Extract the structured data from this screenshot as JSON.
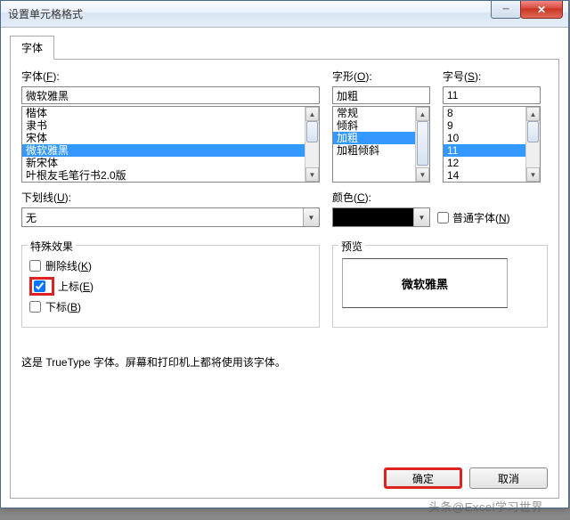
{
  "window": {
    "title": "设置单元格格式"
  },
  "tab": {
    "label": "字体"
  },
  "font": {
    "label": "字体(",
    "accel": "F",
    "label2": "):",
    "value": "微软雅黑",
    "list": [
      "楷体",
      "隶书",
      "宋体",
      "微软雅黑",
      "新宋体",
      "叶根友毛笔行书2.0版"
    ]
  },
  "style": {
    "label": "字形(",
    "accel": "O",
    "label2": "):",
    "value": "加粗",
    "list": [
      "常规",
      "倾斜",
      "加粗",
      "加粗倾斜"
    ]
  },
  "size": {
    "label": "字号(",
    "accel": "S",
    "label2": "):",
    "value": "11",
    "list": [
      "8",
      "9",
      "10",
      "11",
      "12",
      "14"
    ]
  },
  "underline": {
    "label": "下划线(",
    "accel": "U",
    "label2": "):",
    "value": "无"
  },
  "color": {
    "label": "颜色(",
    "accel": "C",
    "label2": "):"
  },
  "normalFont": {
    "label": "普通字体(",
    "accel": "N",
    "label2": ")"
  },
  "effects": {
    "title": "特殊效果",
    "strike": {
      "label": "删除线(",
      "accel": "K",
      "label2": ")"
    },
    "super": {
      "label": "上标(",
      "accel": "E",
      "label2": ")"
    },
    "sub": {
      "label": "下标(",
      "accel": "B",
      "label2": ")"
    }
  },
  "preview": {
    "title": "预览",
    "sample": "微软雅黑"
  },
  "footer": "这是 TrueType 字体。屏幕和打印机上都将使用该字体。",
  "buttons": {
    "ok": "确定",
    "cancel": "取消"
  },
  "watermark": "头条@Excel学习世界"
}
